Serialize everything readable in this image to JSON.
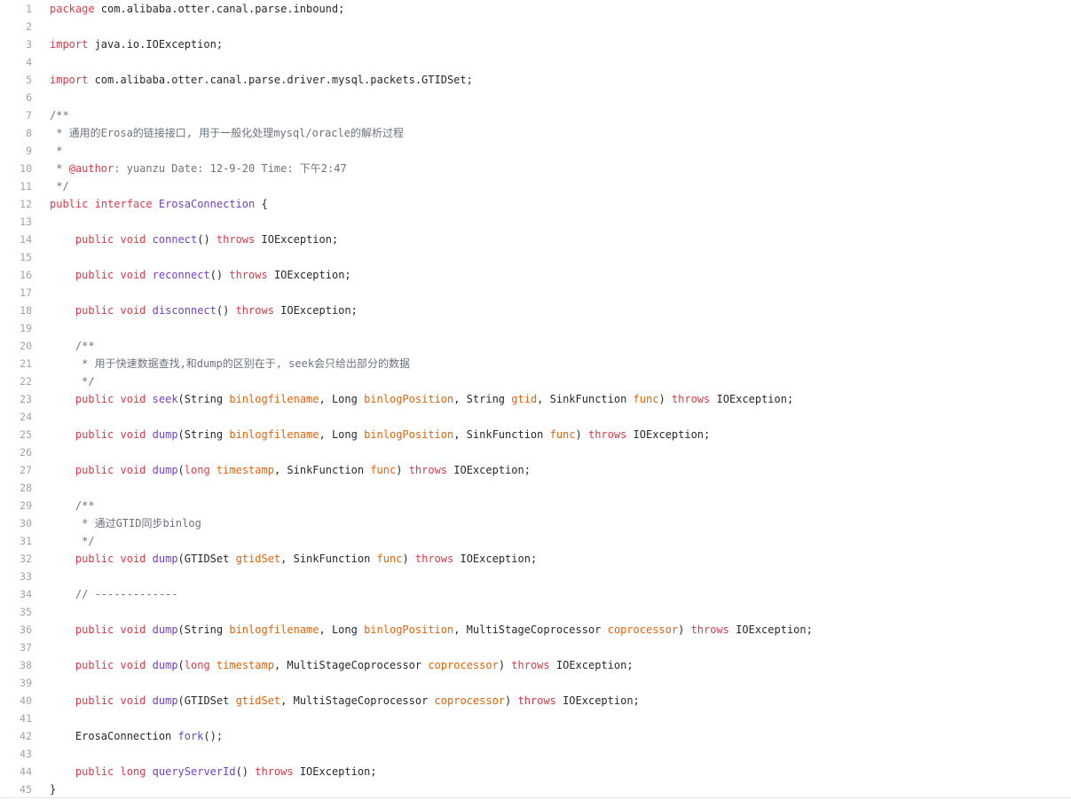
{
  "colors": {
    "background": "#ffffff",
    "line_number": "#9ba3ab",
    "text": "#24292e",
    "keyword": "#d73a49",
    "function": "#6f42c1",
    "parameter": "#e36209",
    "comment": "#6a737d"
  },
  "lines": [
    {
      "n": "1",
      "segs": [
        {
          "c": "k",
          "t": "package"
        },
        {
          "c": "t",
          "t": " com.alibaba.otter.canal.parse.inbound;"
        }
      ]
    },
    {
      "n": "2",
      "segs": []
    },
    {
      "n": "3",
      "segs": [
        {
          "c": "k",
          "t": "import"
        },
        {
          "c": "t",
          "t": " java.io.IOException;"
        }
      ]
    },
    {
      "n": "4",
      "segs": []
    },
    {
      "n": "5",
      "segs": [
        {
          "c": "k",
          "t": "import"
        },
        {
          "c": "t",
          "t": " com.alibaba.otter.canal.parse.driver.mysql.packets.GTIDSet;"
        }
      ]
    },
    {
      "n": "6",
      "segs": []
    },
    {
      "n": "7",
      "segs": [
        {
          "c": "c",
          "t": "/**"
        }
      ]
    },
    {
      "n": "8",
      "segs": [
        {
          "c": "c",
          "t": " * 通用的Erosa的链接接口, 用于一般化处理mysql/oracle的解析过程"
        }
      ]
    },
    {
      "n": "9",
      "segs": [
        {
          "c": "c",
          "t": " *"
        }
      ]
    },
    {
      "n": "10",
      "segs": [
        {
          "c": "c",
          "t": " * "
        },
        {
          "c": "k",
          "t": "@author"
        },
        {
          "c": "c",
          "t": ": yuanzu Date: 12-9-20 Time: 下午2:47"
        }
      ]
    },
    {
      "n": "11",
      "segs": [
        {
          "c": "c",
          "t": " */"
        }
      ]
    },
    {
      "n": "12",
      "segs": [
        {
          "c": "k",
          "t": "public"
        },
        {
          "c": "t",
          "t": " "
        },
        {
          "c": "k",
          "t": "interface"
        },
        {
          "c": "t",
          "t": " "
        },
        {
          "c": "f",
          "t": "ErosaConnection"
        },
        {
          "c": "t",
          "t": " {"
        }
      ]
    },
    {
      "n": "13",
      "segs": []
    },
    {
      "n": "14",
      "segs": [
        {
          "c": "t",
          "t": "    "
        },
        {
          "c": "k",
          "t": "public"
        },
        {
          "c": "t",
          "t": " "
        },
        {
          "c": "k",
          "t": "void"
        },
        {
          "c": "t",
          "t": " "
        },
        {
          "c": "f",
          "t": "connect"
        },
        {
          "c": "t",
          "t": "() "
        },
        {
          "c": "k",
          "t": "throws"
        },
        {
          "c": "t",
          "t": " IOException;"
        }
      ]
    },
    {
      "n": "15",
      "segs": []
    },
    {
      "n": "16",
      "segs": [
        {
          "c": "t",
          "t": "    "
        },
        {
          "c": "k",
          "t": "public"
        },
        {
          "c": "t",
          "t": " "
        },
        {
          "c": "k",
          "t": "void"
        },
        {
          "c": "t",
          "t": " "
        },
        {
          "c": "f",
          "t": "reconnect"
        },
        {
          "c": "t",
          "t": "() "
        },
        {
          "c": "k",
          "t": "throws"
        },
        {
          "c": "t",
          "t": " IOException;"
        }
      ]
    },
    {
      "n": "17",
      "segs": []
    },
    {
      "n": "18",
      "segs": [
        {
          "c": "t",
          "t": "    "
        },
        {
          "c": "k",
          "t": "public"
        },
        {
          "c": "t",
          "t": " "
        },
        {
          "c": "k",
          "t": "void"
        },
        {
          "c": "t",
          "t": " "
        },
        {
          "c": "f",
          "t": "disconnect"
        },
        {
          "c": "t",
          "t": "() "
        },
        {
          "c": "k",
          "t": "throws"
        },
        {
          "c": "t",
          "t": " IOException;"
        }
      ]
    },
    {
      "n": "19",
      "segs": []
    },
    {
      "n": "20",
      "segs": [
        {
          "c": "t",
          "t": "    "
        },
        {
          "c": "c",
          "t": "/**"
        }
      ]
    },
    {
      "n": "21",
      "segs": [
        {
          "c": "t",
          "t": "    "
        },
        {
          "c": "c",
          "t": " * 用于快速数据查找,和dump的区别在于, seek会只给出部分的数据"
        }
      ]
    },
    {
      "n": "22",
      "segs": [
        {
          "c": "t",
          "t": "    "
        },
        {
          "c": "c",
          "t": " */"
        }
      ]
    },
    {
      "n": "23",
      "segs": [
        {
          "c": "t",
          "t": "    "
        },
        {
          "c": "k",
          "t": "public"
        },
        {
          "c": "t",
          "t": " "
        },
        {
          "c": "k",
          "t": "void"
        },
        {
          "c": "t",
          "t": " "
        },
        {
          "c": "f",
          "t": "seek"
        },
        {
          "c": "t",
          "t": "(String "
        },
        {
          "c": "p",
          "t": "binlogfilename"
        },
        {
          "c": "t",
          "t": ", Long "
        },
        {
          "c": "p",
          "t": "binlogPosition"
        },
        {
          "c": "t",
          "t": ", String "
        },
        {
          "c": "p",
          "t": "gtid"
        },
        {
          "c": "t",
          "t": ", SinkFunction "
        },
        {
          "c": "p",
          "t": "func"
        },
        {
          "c": "t",
          "t": ") "
        },
        {
          "c": "k",
          "t": "throws"
        },
        {
          "c": "t",
          "t": " IOException;"
        }
      ]
    },
    {
      "n": "24",
      "segs": []
    },
    {
      "n": "25",
      "segs": [
        {
          "c": "t",
          "t": "    "
        },
        {
          "c": "k",
          "t": "public"
        },
        {
          "c": "t",
          "t": " "
        },
        {
          "c": "k",
          "t": "void"
        },
        {
          "c": "t",
          "t": " "
        },
        {
          "c": "f",
          "t": "dump"
        },
        {
          "c": "t",
          "t": "(String "
        },
        {
          "c": "p",
          "t": "binlogfilename"
        },
        {
          "c": "t",
          "t": ", Long "
        },
        {
          "c": "p",
          "t": "binlogPosition"
        },
        {
          "c": "t",
          "t": ", SinkFunction "
        },
        {
          "c": "p",
          "t": "func"
        },
        {
          "c": "t",
          "t": ") "
        },
        {
          "c": "k",
          "t": "throws"
        },
        {
          "c": "t",
          "t": " IOException;"
        }
      ]
    },
    {
      "n": "26",
      "segs": []
    },
    {
      "n": "27",
      "segs": [
        {
          "c": "t",
          "t": "    "
        },
        {
          "c": "k",
          "t": "public"
        },
        {
          "c": "t",
          "t": " "
        },
        {
          "c": "k",
          "t": "void"
        },
        {
          "c": "t",
          "t": " "
        },
        {
          "c": "f",
          "t": "dump"
        },
        {
          "c": "t",
          "t": "("
        },
        {
          "c": "k",
          "t": "long"
        },
        {
          "c": "t",
          "t": " "
        },
        {
          "c": "p",
          "t": "timestamp"
        },
        {
          "c": "t",
          "t": ", SinkFunction "
        },
        {
          "c": "p",
          "t": "func"
        },
        {
          "c": "t",
          "t": ") "
        },
        {
          "c": "k",
          "t": "throws"
        },
        {
          "c": "t",
          "t": " IOException;"
        }
      ]
    },
    {
      "n": "28",
      "segs": []
    },
    {
      "n": "29",
      "segs": [
        {
          "c": "t",
          "t": "    "
        },
        {
          "c": "c",
          "t": "/**"
        }
      ]
    },
    {
      "n": "30",
      "segs": [
        {
          "c": "t",
          "t": "    "
        },
        {
          "c": "c",
          "t": " * 通过GTID同步binlog"
        }
      ]
    },
    {
      "n": "31",
      "segs": [
        {
          "c": "t",
          "t": "    "
        },
        {
          "c": "c",
          "t": " */"
        }
      ]
    },
    {
      "n": "32",
      "segs": [
        {
          "c": "t",
          "t": "    "
        },
        {
          "c": "k",
          "t": "public"
        },
        {
          "c": "t",
          "t": " "
        },
        {
          "c": "k",
          "t": "void"
        },
        {
          "c": "t",
          "t": " "
        },
        {
          "c": "f",
          "t": "dump"
        },
        {
          "c": "t",
          "t": "(GTIDSet "
        },
        {
          "c": "p",
          "t": "gtidSet"
        },
        {
          "c": "t",
          "t": ", SinkFunction "
        },
        {
          "c": "p",
          "t": "func"
        },
        {
          "c": "t",
          "t": ") "
        },
        {
          "c": "k",
          "t": "throws"
        },
        {
          "c": "t",
          "t": " IOException;"
        }
      ]
    },
    {
      "n": "33",
      "segs": []
    },
    {
      "n": "34",
      "segs": [
        {
          "c": "t",
          "t": "    "
        },
        {
          "c": "c",
          "t": "// -------------"
        }
      ]
    },
    {
      "n": "35",
      "segs": []
    },
    {
      "n": "36",
      "segs": [
        {
          "c": "t",
          "t": "    "
        },
        {
          "c": "k",
          "t": "public"
        },
        {
          "c": "t",
          "t": " "
        },
        {
          "c": "k",
          "t": "void"
        },
        {
          "c": "t",
          "t": " "
        },
        {
          "c": "f",
          "t": "dump"
        },
        {
          "c": "t",
          "t": "(String "
        },
        {
          "c": "p",
          "t": "binlogfilename"
        },
        {
          "c": "t",
          "t": ", Long "
        },
        {
          "c": "p",
          "t": "binlogPosition"
        },
        {
          "c": "t",
          "t": ", MultiStageCoprocessor "
        },
        {
          "c": "p",
          "t": "coprocessor"
        },
        {
          "c": "t",
          "t": ") "
        },
        {
          "c": "k",
          "t": "throws"
        },
        {
          "c": "t",
          "t": " IOException;"
        }
      ]
    },
    {
      "n": "37",
      "segs": []
    },
    {
      "n": "38",
      "segs": [
        {
          "c": "t",
          "t": "    "
        },
        {
          "c": "k",
          "t": "public"
        },
        {
          "c": "t",
          "t": " "
        },
        {
          "c": "k",
          "t": "void"
        },
        {
          "c": "t",
          "t": " "
        },
        {
          "c": "f",
          "t": "dump"
        },
        {
          "c": "t",
          "t": "("
        },
        {
          "c": "k",
          "t": "long"
        },
        {
          "c": "t",
          "t": " "
        },
        {
          "c": "p",
          "t": "timestamp"
        },
        {
          "c": "t",
          "t": ", MultiStageCoprocessor "
        },
        {
          "c": "p",
          "t": "coprocessor"
        },
        {
          "c": "t",
          "t": ") "
        },
        {
          "c": "k",
          "t": "throws"
        },
        {
          "c": "t",
          "t": " IOException;"
        }
      ]
    },
    {
      "n": "39",
      "segs": []
    },
    {
      "n": "40",
      "segs": [
        {
          "c": "t",
          "t": "    "
        },
        {
          "c": "k",
          "t": "public"
        },
        {
          "c": "t",
          "t": " "
        },
        {
          "c": "k",
          "t": "void"
        },
        {
          "c": "t",
          "t": " "
        },
        {
          "c": "f",
          "t": "dump"
        },
        {
          "c": "t",
          "t": "(GTIDSet "
        },
        {
          "c": "p",
          "t": "gtidSet"
        },
        {
          "c": "t",
          "t": ", MultiStageCoprocessor "
        },
        {
          "c": "p",
          "t": "coprocessor"
        },
        {
          "c": "t",
          "t": ") "
        },
        {
          "c": "k",
          "t": "throws"
        },
        {
          "c": "t",
          "t": " IOException;"
        }
      ]
    },
    {
      "n": "41",
      "segs": []
    },
    {
      "n": "42",
      "segs": [
        {
          "c": "t",
          "t": "    ErosaConnection "
        },
        {
          "c": "f",
          "t": "fork"
        },
        {
          "c": "t",
          "t": "();"
        }
      ]
    },
    {
      "n": "43",
      "segs": []
    },
    {
      "n": "44",
      "segs": [
        {
          "c": "t",
          "t": "    "
        },
        {
          "c": "k",
          "t": "public"
        },
        {
          "c": "t",
          "t": " "
        },
        {
          "c": "k",
          "t": "long"
        },
        {
          "c": "t",
          "t": " "
        },
        {
          "c": "f",
          "t": "queryServerId"
        },
        {
          "c": "t",
          "t": "() "
        },
        {
          "c": "k",
          "t": "throws"
        },
        {
          "c": "t",
          "t": " IOException;"
        }
      ]
    },
    {
      "n": "45",
      "segs": [
        {
          "c": "t",
          "t": "}"
        }
      ]
    }
  ]
}
